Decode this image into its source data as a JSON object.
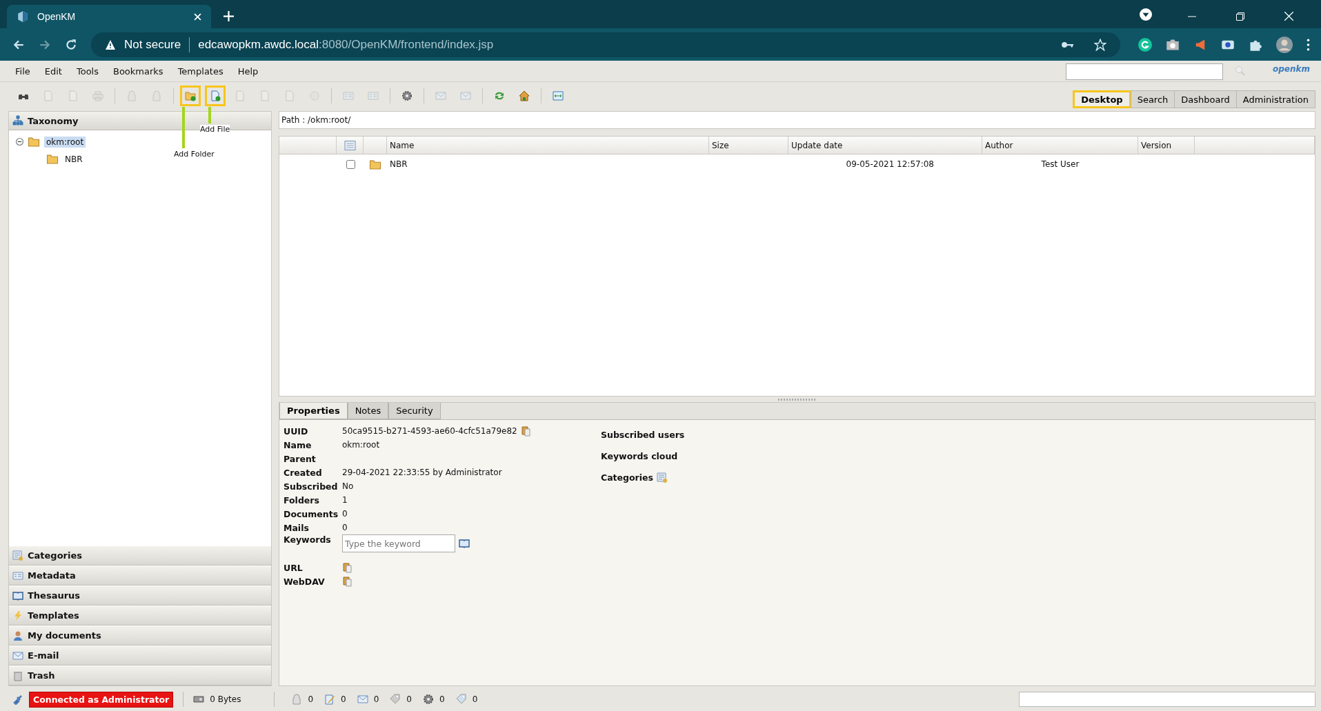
{
  "browser": {
    "tab_title": "OpenKM",
    "security": "Not secure",
    "url_host": "edcawopkm.awdc.local",
    "url_path": ":8080/OpenKM/frontend/index.jsp"
  },
  "menu": [
    "File",
    "Edit",
    "Tools",
    "Bookmarks",
    "Templates",
    "Help"
  ],
  "header": {
    "logo_text": "openkm"
  },
  "annotations": [
    {
      "text": "Add File"
    },
    {
      "text": "Add Folder"
    }
  ],
  "toolbar": [
    [
      {
        "disabled": false,
        "highlighted": false
      },
      {
        "disabled": true,
        "highlighted": false
      },
      {
        "disabled": true,
        "highlighted": false
      },
      {
        "disabled": true,
        "highlighted": false
      }
    ],
    [
      {
        "disabled": true,
        "highlighted": false
      },
      {
        "disabled": true,
        "highlighted": false
      }
    ],
    [
      {
        "disabled": false,
        "highlighted": true
      },
      {
        "disabled": false,
        "highlighted": true
      },
      {
        "disabled": true,
        "highlighted": false
      },
      {
        "disabled": true,
        "highlighted": false
      },
      {
        "disabled": true,
        "highlighted": false
      },
      {
        "disabled": true,
        "highlighted": false
      }
    ],
    [
      {
        "disabled": true,
        "highlighted": false
      },
      {
        "disabled": true,
        "highlighted": false
      }
    ],
    [
      {
        "disabled": false,
        "highlighted": false
      }
    ],
    [
      {
        "disabled": true,
        "highlighted": false
      },
      {
        "disabled": true,
        "highlighted": false
      }
    ],
    [
      {
        "disabled": false,
        "highlighted": false
      },
      {
        "disabled": false,
        "highlighted": false
      }
    ],
    [
      {
        "disabled": false,
        "highlighted": false
      }
    ]
  ],
  "tabs": [
    {
      "label": "Desktop",
      "selected": true,
      "highlighted": true
    },
    {
      "label": "Search",
      "selected": false,
      "highlighted": false
    },
    {
      "label": "Dashboard",
      "selected": false,
      "highlighted": false
    },
    {
      "label": "Administration",
      "selected": false,
      "highlighted": false
    }
  ],
  "sidebar": {
    "title": "Taxonomy",
    "tree": [
      {
        "label": "okm:root",
        "selected": true,
        "expanded": true,
        "children": [
          {
            "label": "NBR",
            "selected": false
          }
        ]
      }
    ],
    "panels": [
      "Categories",
      "Metadata",
      "Thesaurus",
      "Templates",
      "My documents",
      "E-mail",
      "Trash"
    ]
  },
  "path": "Path : /okm:root/",
  "table": {
    "columns": [
      "",
      "",
      "",
      "Name",
      "Size",
      "Update date",
      "Author",
      "Version",
      ""
    ],
    "rows": [
      {
        "checked": false,
        "name": "NBR",
        "update_date": "09-05-2021 12:57:08",
        "author": "Test User"
      }
    ]
  },
  "properties": {
    "tabs": [
      {
        "label": "Properties",
        "selected": true
      },
      {
        "label": "Notes",
        "selected": false
      },
      {
        "label": "Security",
        "selected": false
      }
    ],
    "fields": [
      {
        "label": "UUID",
        "value": "50ca9515-b271-4593-ae60-4cfc51a79e82",
        "kind": "copy-text"
      },
      {
        "label": "Name",
        "value": "okm:root",
        "kind": "text"
      },
      {
        "label": "Parent",
        "kind": "text"
      },
      {
        "label": "Created",
        "value": "29-04-2021 22:33:55 by Administrator",
        "kind": "text"
      },
      {
        "label": "Subscribed",
        "value": "No",
        "kind": "text"
      },
      {
        "label": "Folders",
        "value": "1",
        "kind": "text"
      },
      {
        "label": "Documents",
        "value": "0",
        "kind": "text"
      },
      {
        "label": "Mails",
        "value": "0",
        "kind": "text"
      },
      {
        "label": "Keywords",
        "placeholder": "Type the keyword",
        "kind": "keywords"
      },
      {
        "label": "URL",
        "kind": "copy"
      },
      {
        "label": "WebDAV",
        "kind": "copy"
      }
    ],
    "side": [
      {
        "label": "Subscribed users",
        "kind": "text"
      },
      {
        "label": "Keywords cloud",
        "kind": "text"
      },
      {
        "label": "Categories",
        "kind": "categories"
      }
    ]
  },
  "status_bar": {
    "user": "Connected as Administrator",
    "size": "0 Bytes",
    "counters": [
      "0",
      "0",
      "0",
      "0",
      "0",
      "0"
    ]
  }
}
